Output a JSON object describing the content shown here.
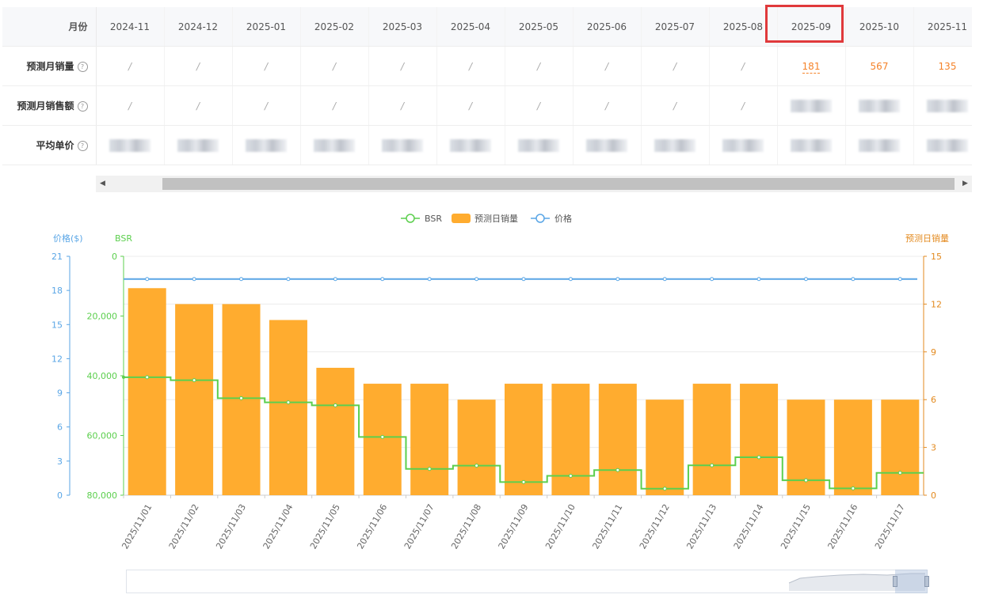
{
  "table": {
    "row_headers": [
      "月份",
      "预测月销量",
      "预测月销售额",
      "平均单价"
    ],
    "months": [
      "2024-11",
      "2024-12",
      "2025-01",
      "2025-02",
      "2025-03",
      "2025-04",
      "2025-05",
      "2025-06",
      "2025-07",
      "2025-08",
      "2025-09",
      "2025-10",
      "2025-11"
    ],
    "placeholder": "/",
    "monthly_sales": [
      "/",
      "/",
      "/",
      "/",
      "/",
      "/",
      "/",
      "/",
      "/",
      "/",
      "181",
      "567",
      "135"
    ],
    "highlighted_month": "2025-09"
  },
  "legend": {
    "bsr": "BSR",
    "sales": "预测日销量",
    "price": "价格"
  },
  "axes": {
    "price_label": "价格($)",
    "bsr_label": "BSR",
    "sales_label": "预测日销量"
  },
  "colors": {
    "bsr": "#5ccf4e",
    "sales": "#ffac2f",
    "price": "#5aa6e6",
    "highlight": "#e0393b"
  },
  "chart_data": {
    "type": "bar",
    "categories": [
      "2025/11/01",
      "2025/11/02",
      "2025/11/03",
      "2025/11/04",
      "2025/11/05",
      "2025/11/06",
      "2025/11/07",
      "2025/11/08",
      "2025/11/09",
      "2025/11/10",
      "2025/11/11",
      "2025/11/12",
      "2025/11/13",
      "2025/11/14",
      "2025/11/15",
      "2025/11/16",
      "2025/11/17"
    ],
    "series": [
      {
        "name": "预测日销量",
        "type": "bar",
        "axis": "right",
        "values": [
          13,
          12,
          12,
          11,
          8,
          7,
          7,
          6,
          7,
          7,
          7,
          6,
          7,
          7,
          6,
          6,
          6
        ]
      },
      {
        "name": "BSR",
        "type": "step-line",
        "axis": "left-inner",
        "inverted": true,
        "values": [
          40500,
          41500,
          47500,
          48900,
          49900,
          60500,
          71200,
          70100,
          75600,
          73500,
          71600,
          77800,
          70000,
          67300,
          75000,
          77700,
          72500
        ]
      },
      {
        "name": "价格",
        "type": "line",
        "axis": "left-outer",
        "values": [
          19,
          19,
          19,
          19,
          19,
          19,
          19,
          19,
          19,
          19,
          19,
          19,
          19,
          19,
          19,
          19,
          19
        ]
      }
    ],
    "price_axis": {
      "min": 0,
      "max": 21,
      "ticks": [
        0,
        3,
        6,
        9,
        12,
        15,
        18,
        21
      ]
    },
    "bsr_axis": {
      "min": 0,
      "max": 80000,
      "ticks": [
        "0",
        "20,000",
        "40,000",
        "60,000",
        "80,000"
      ]
    },
    "sales_axis": {
      "min": 0,
      "max": 15,
      "ticks": [
        0,
        3,
        6,
        9,
        12,
        15
      ]
    },
    "legend_position": "top-center",
    "grid": true
  }
}
